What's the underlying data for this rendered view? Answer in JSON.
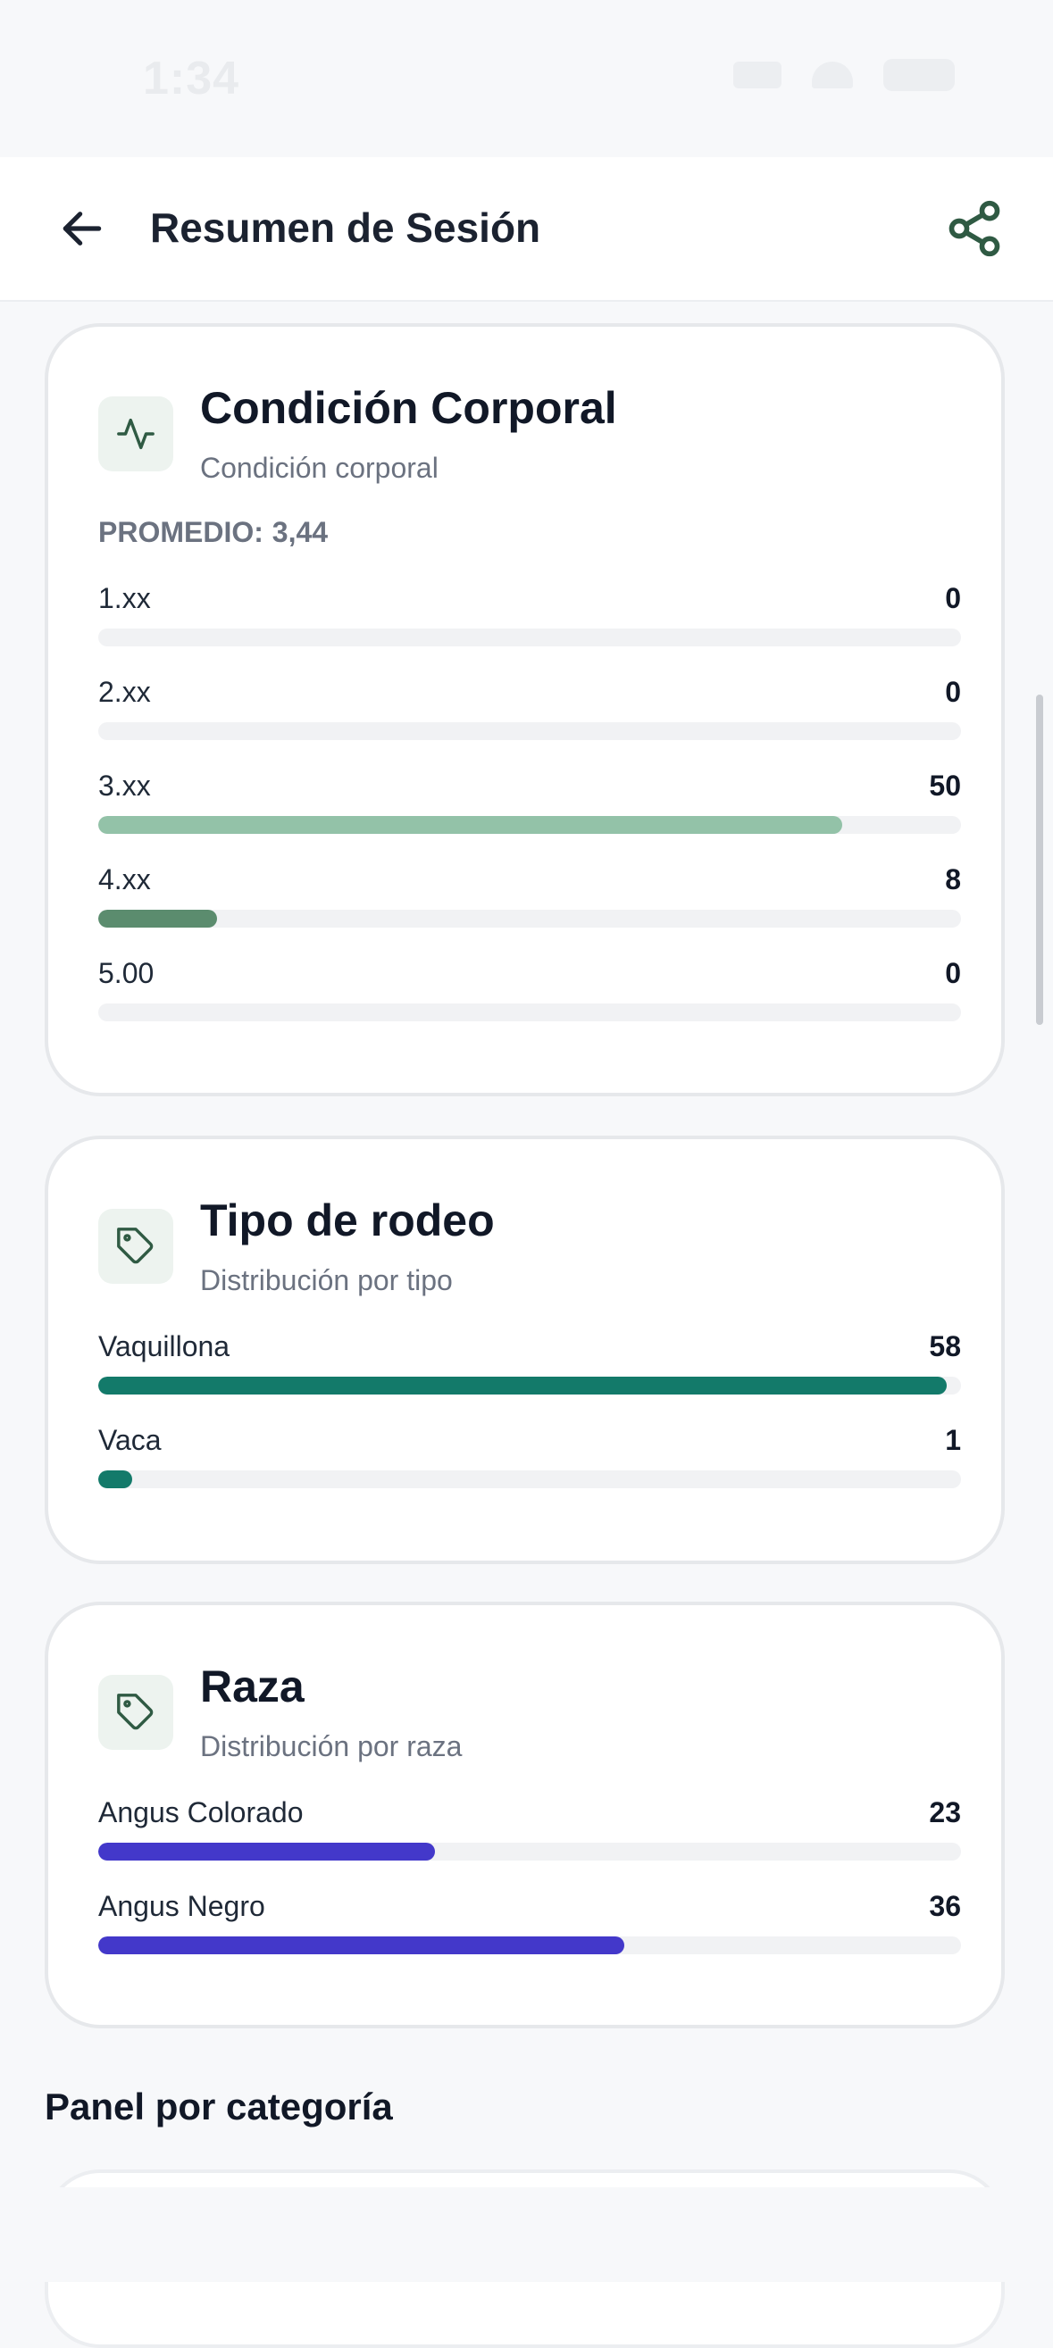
{
  "status_bar": {
    "time": "1:34"
  },
  "header": {
    "title": "Resumen de Sesión"
  },
  "cards": {
    "condicion": {
      "title": "Condición Corporal",
      "subtitle": "Condición corporal",
      "average_label": "PROMEDIO:",
      "average_value": "3,44",
      "rows": [
        {
          "label": "1.xx",
          "value": 0,
          "fraction": 0,
          "color": "#8fbfa6"
        },
        {
          "label": "2.xx",
          "value": 0,
          "fraction": 0,
          "color": "#8fbfa6"
        },
        {
          "label": "3.xx",
          "value": 50,
          "fraction": 0.862,
          "color": "#93c2a8"
        },
        {
          "label": "4.xx",
          "value": 8,
          "fraction": 0.138,
          "color": "#5b8c6e"
        },
        {
          "label": "5.00",
          "value": 0,
          "fraction": 0,
          "color": "#8fbfa6"
        }
      ]
    },
    "rodeo": {
      "title": "Tipo de rodeo",
      "subtitle": "Distribución por tipo",
      "rows": [
        {
          "label": "Vaquillona",
          "value": 58,
          "fraction": 0.983,
          "color": "#137a6a"
        },
        {
          "label": "Vaca",
          "value": 1,
          "fraction": 0.039,
          "color": "#137a6a"
        }
      ]
    },
    "raza": {
      "title": "Raza",
      "subtitle": "Distribución por raza",
      "rows": [
        {
          "label": "Angus Colorado",
          "value": 23,
          "fraction": 0.39,
          "color": "#4338ca"
        },
        {
          "label": "Angus Negro",
          "value": 36,
          "fraction": 0.61,
          "color": "#4338ca"
        }
      ]
    }
  },
  "section": {
    "title": "Panel por categoría"
  },
  "icons": {
    "back": "arrow-left-icon",
    "share": "share-icon",
    "condicion": "activity-icon",
    "rodeo": "tag-icon",
    "raza": "tag-icon"
  },
  "colors": {
    "accent": "#2f5a43",
    "icon_bg": "#edf3ef"
  }
}
